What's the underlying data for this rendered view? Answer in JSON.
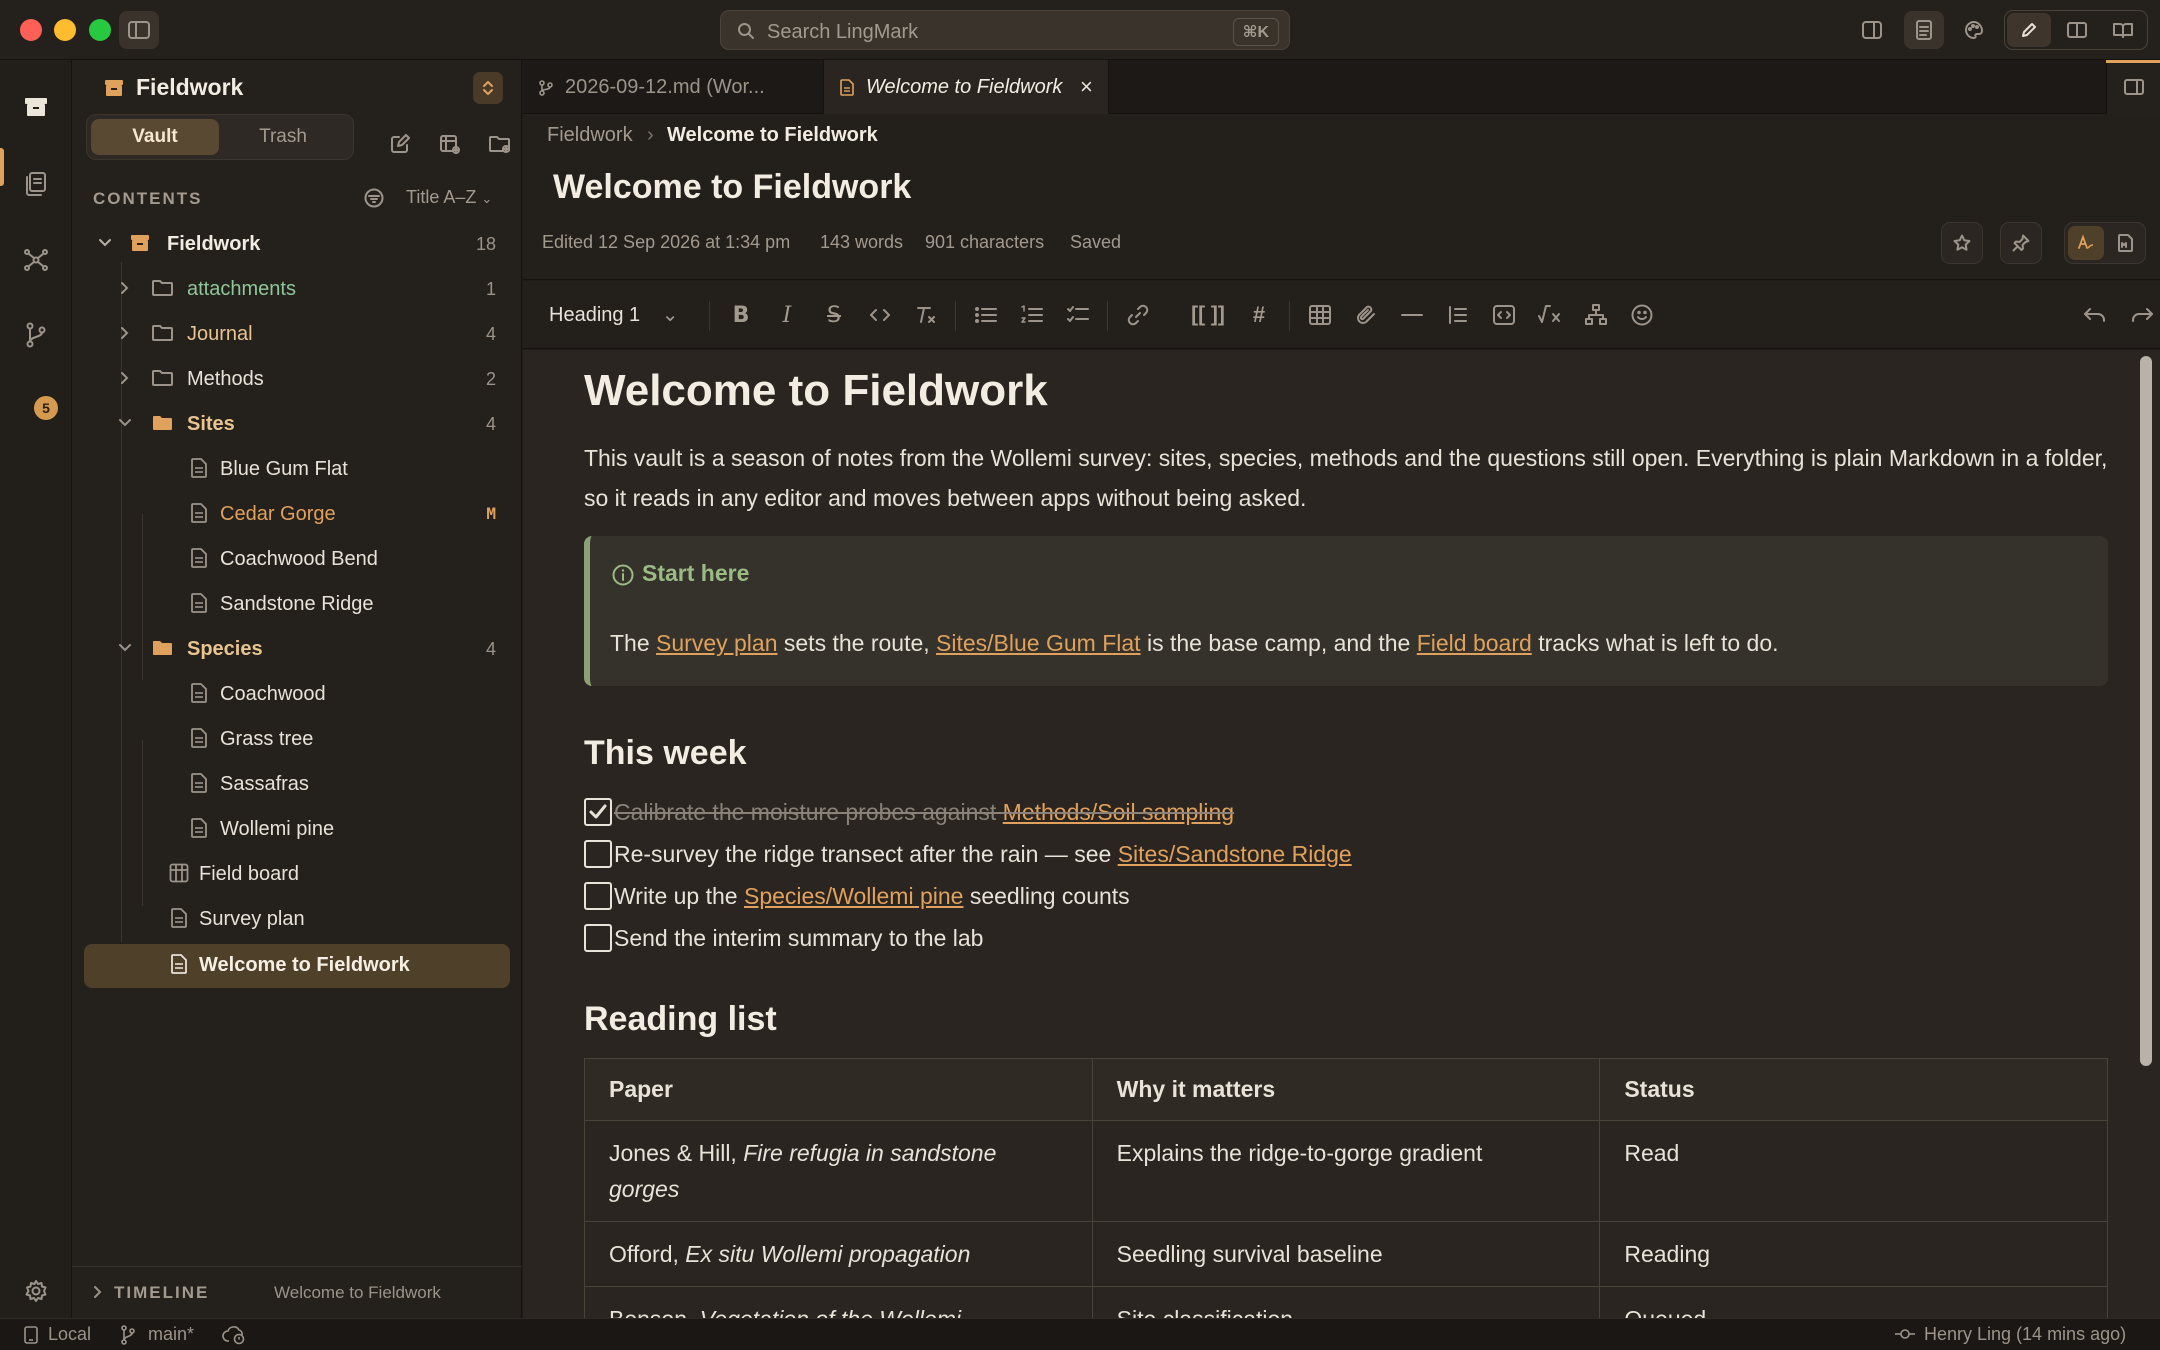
{
  "app": {
    "search_placeholder": "Search LingMark",
    "search_shortcut": "⌘K"
  },
  "activity": {
    "git_badge": "5"
  },
  "sidebar": {
    "vault_name": "Fieldwork",
    "segments": {
      "vault": "Vault",
      "trash": "Trash"
    },
    "contents_label": "CONTENTS",
    "sort_label": "Title A–Z",
    "tree": {
      "root": {
        "label": "Fieldwork",
        "count": "18"
      },
      "attachments": {
        "label": "attachments",
        "count": "1"
      },
      "journal": {
        "label": "Journal",
        "count": "4"
      },
      "methods": {
        "label": "Methods",
        "count": "2"
      },
      "sites": {
        "label": "Sites",
        "count": "4"
      },
      "site_files": [
        {
          "label": "Blue Gum Flat",
          "badge": ""
        },
        {
          "label": "Cedar Gorge",
          "badge": "M"
        },
        {
          "label": "Coachwood Bend",
          "badge": ""
        },
        {
          "label": "Sandstone Ridge",
          "badge": ""
        }
      ],
      "species": {
        "label": "Species",
        "count": "4"
      },
      "species_files": [
        {
          "label": "Coachwood"
        },
        {
          "label": "Grass tree"
        },
        {
          "label": "Sassafras"
        },
        {
          "label": "Wollemi pine"
        }
      ],
      "field_board": "Field board",
      "survey_plan": "Survey plan",
      "welcome": "Welcome to Fieldwork"
    },
    "timeline_label": "TIMELINE",
    "timeline_doc": "Welcome to Fieldwork"
  },
  "statusbar": {
    "storage": "Local",
    "branch": "main*",
    "author": "Henry Ling (14 mins ago)"
  },
  "tabs": [
    {
      "label": "2026-09-12.md (Wor..."
    },
    {
      "label": "Welcome to Fieldwork",
      "close": "×"
    }
  ],
  "doc": {
    "breadcrumb": [
      "Fieldwork",
      "Welcome to Fieldwork"
    ],
    "breadcrumb_sep": "›",
    "title": "Welcome to Fieldwork",
    "edited": "Edited 12 Sep 2026 at 1:34 pm",
    "words": "143 words",
    "characters": "901 characters",
    "save_state": "Saved"
  },
  "toolbar": {
    "block_type": "Heading 1",
    "wikilink": "[[ ]]",
    "tag": "#"
  },
  "content": {
    "h1": "Welcome to Fieldwork",
    "intro": "This vault is a season of notes from the Wollemi survey: sites, species, methods and the questions still open. Everything is plain Markdown in a folder, so it reads in any editor and moves between apps without being asked.",
    "callout": {
      "title": "Start here",
      "t1": "The ",
      "l1": "Survey plan",
      "t2": " sets the route, ",
      "l2": "Sites/Blue Gum Flat",
      "t3": " is the base camp, and the ",
      "l3": "Field board",
      "t4": " tracks what is left to do."
    },
    "this_week": "This week",
    "tasks": [
      {
        "done": true,
        "text": "Calibrate the moisture probes against ",
        "link": "Methods/Soil sampling",
        "after": ""
      },
      {
        "done": false,
        "text": "Re-survey the ridge transect after the rain — see ",
        "link": "Sites/Sandstone Ridge",
        "after": ""
      },
      {
        "done": false,
        "text": "Write up the ",
        "link": "Species/Wollemi pine",
        "after": " seedling counts"
      },
      {
        "done": false,
        "text": "Send the interim summary to the lab",
        "link": "",
        "after": ""
      }
    ],
    "reading_list": "Reading list",
    "table": {
      "headers": [
        "Paper",
        "Why it matters",
        "Status"
      ],
      "rows": [
        {
          "author": "Jones & Hill, ",
          "title": "Fire refugia in sandstone gorges",
          "why": "Explains the ridge-to-gorge gradient",
          "status": "Read"
        },
        {
          "author": "Offord, ",
          "title": "Ex situ Wollemi propagation",
          "why": "Seedling survival baseline",
          "status": "Reading"
        },
        {
          "author": "Benson, ",
          "title": "Vegetation of the Wollemi",
          "why": "Site classification",
          "status": "Queued"
        }
      ]
    }
  },
  "colors": {
    "accent": "#e0a15c",
    "callout_green": "#9cbb84",
    "background": "#2a2520"
  }
}
